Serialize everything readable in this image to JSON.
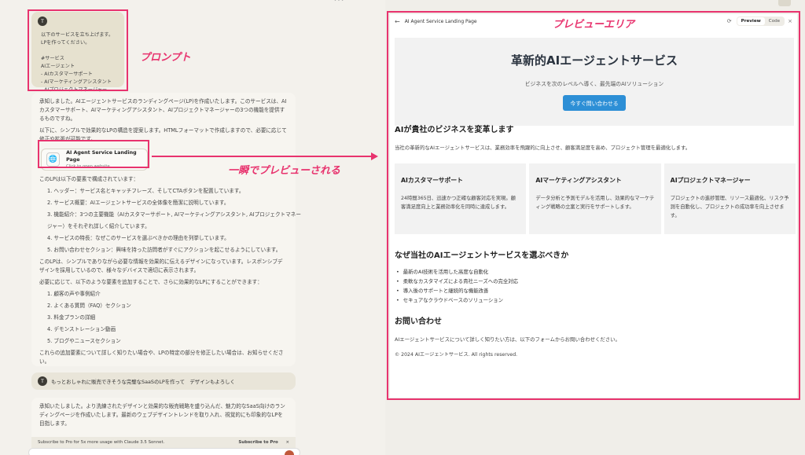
{
  "prompt": {
    "avatar": "T",
    "lines": [
      "以下のサービスを立ち上げます。",
      "LPを作ってください。",
      "",
      "#サービス",
      "AIエージェント",
      "- AIカスタマーサポート",
      "- AIマーケティングアシスタント",
      "- AIプロジェクトマネージャー"
    ]
  },
  "annotations": {
    "prompt_label": "プロンプト",
    "preview_label": "プレビューエリア",
    "instant_label": "一瞬でプレビューされる"
  },
  "assistant": {
    "intro1": "承知しました。AIエージェントサービスのランディングページ(LP)を作成いたします。このサービスは、AIカスタマーサポート、AIマーケティングアシスタント、AIプロジェクトマネージャーの3つの機能を提供するものですね。",
    "intro2": "以下に、シンプルで効果的なLPの構造を提案します。HTMLフォーマットで作成しますので、必要に応じて修正や拡張が可能です。",
    "file_card": {
      "icon": "globe-icon",
      "title": "AI Agent Service Landing Page",
      "subtitle": "Click to open website"
    },
    "structure_intro": "このLPは以下の要素で構成されています：",
    "structure": [
      "1. ヘッダー：サービス名とキャッチフレーズ、そしてCTAボタンを配置しています。",
      "2. サービス概要：AIエージェントサービスの全体像を簡潔に説明しています。",
      "3. 機能紹介：3つの主要機能（AIカスタマーサポート, AIマーケティングアシスタント, AIプロジェクトマネー",
      "    ジャー）をそれぞれ詳しく紹介しています。",
      "4. サービスの特長：なぜこのサービスを選ぶべきかの理由を列挙しています。",
      "5. お問い合わせセクション：興味を持った訪問者がすぐにアクションを起こせるようにしています。"
    ],
    "summary": "このLPは、シンプルでありながら必要な情報を効果的に伝えるデザインになっています。レスポンシブデザインを採用しているので、様々なデバイスで適切に表示されます。",
    "additions_intro": "必要に応じて、以下のような要素を追加することで、さらに効果的なLPにすることができます：",
    "additions": [
      "1. 顧客の声や事例紹介",
      "2. よくある質問（FAQ）セクション",
      "3. 料金プランの詳細",
      "4. デモンストレーション動画",
      "5. ブログやニュースセクション"
    ],
    "closing": "これらの追加要素について詳しく知りたい場合や、LPの特定の部分を修正したい場合は、お知らせください。"
  },
  "user2": {
    "avatar": "T",
    "text": "もっとおしゃれに販売できそうな完璧なSaaSのLPを作って　デザインもよろしく"
  },
  "assistant2": {
    "text": "承知いたしました。より洗練されたデザインと効果的な販売戦略を盛り込んだ、魅力的なSaaS向けのランディングページを作成いたします。最新のウェブデザイントレンドを取り入れ、視覚的にも印象的なLPを目指します。"
  },
  "banner": {
    "text": "Subscribe to Pro for 5x more usage with Claude 3.5 Sonnet.",
    "link": "Subscribe to Pro",
    "close": "×"
  },
  "preview": {
    "header": {
      "back": "←",
      "title": "AI Agent Service Landing Page",
      "refresh": "⟳",
      "tabs": [
        "Preview",
        "Code"
      ],
      "active_tab": "Preview",
      "close": "×"
    },
    "hero": {
      "title": "革新的AIエージェントサービス",
      "subtitle": "ビジネスを次のレベルへ導く、最先端のAIソリューション",
      "cta": "今すぐ問い合わせる"
    },
    "section1": {
      "heading": "AIが貴社のビジネスを変革します",
      "text": "当社の革新的なAIエージェントサービスは、業務効率を飛躍的に向上させ、顧客満足度を高め、プロジェクト管理を最適化します。"
    },
    "features": [
      {
        "title": "AIカスタマーサポート",
        "desc": "24時間365日、迅速かつ正確な顧客対応を実現。顧客満足度向上と業務効率化を同時に達成します。"
      },
      {
        "title": "AIマーケティングアシスタント",
        "desc": "データ分析と予測モデルを活用し、効果的なマーケティング戦略の立案と実行をサポートします。"
      },
      {
        "title": "AIプロジェクトマネージャー",
        "desc": "プロジェクトの進捗管理、リソース最適化、リスク予測を自動化し、プロジェクトの成功率を向上させます。"
      }
    ],
    "section2": {
      "heading": "なぜ当社のAIエージェントサービスを選ぶべきか",
      "bullets": [
        "最新のAI技術を活用した高度な自動化",
        "柔軟なカスタマイズによる貴社ニーズへの完全対応",
        "導入後のサポートと継続的な機能改善",
        "セキュアなクラウドベースのソリューション"
      ]
    },
    "section3": {
      "heading": "お問い合わせ",
      "text": "AIエージェントサービスについて詳しく知りたい方は、以下のフォームからお問い合わせください。"
    },
    "footer": "© 2024 AIエージェントサービス. All rights reserved."
  },
  "colors": {
    "accent": "#e8336e",
    "cta": "#2d8fd6"
  }
}
